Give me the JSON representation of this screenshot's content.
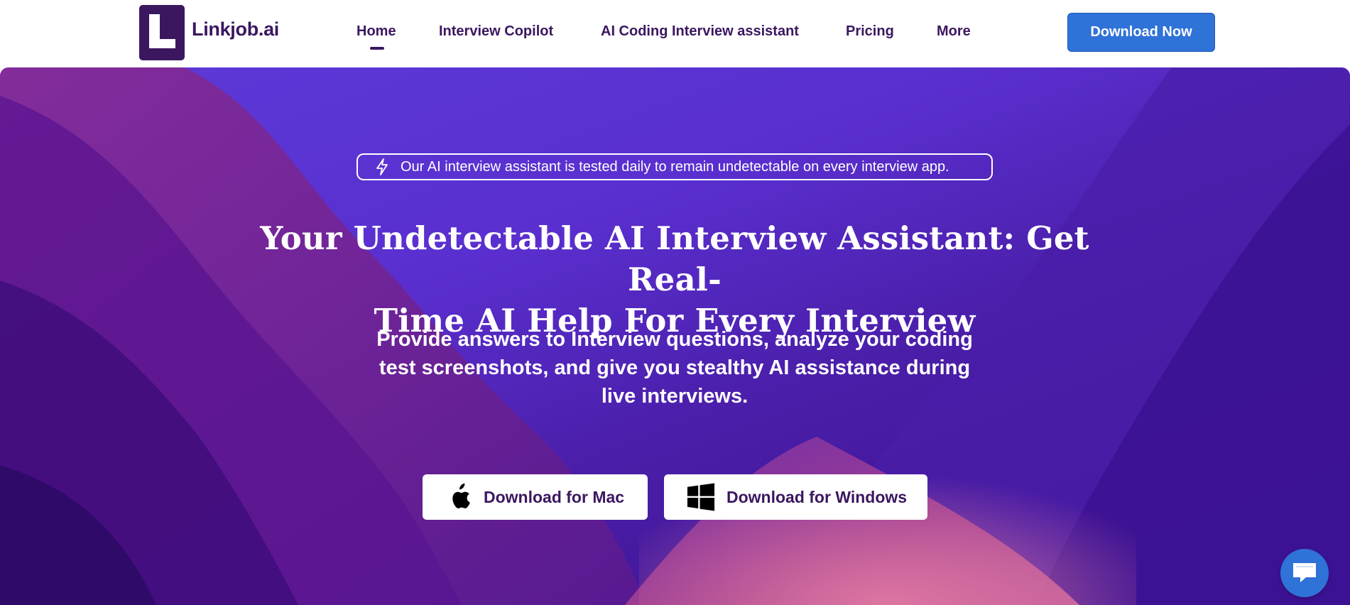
{
  "header": {
    "logo_text": "Linkjob.ai",
    "nav": [
      {
        "label": "Home",
        "active": true
      },
      {
        "label": "Interview Copilot"
      },
      {
        "label": "AI Coding Interview assistant"
      },
      {
        "label": "Pricing"
      },
      {
        "label": "More"
      }
    ],
    "cta_label": "Download Now"
  },
  "hero": {
    "badge_icon": "lightning-icon",
    "badge_text": "Our AI interview assistant is tested daily to remain undetectable on every interview app.",
    "headline_line1": "Your Undetectable AI Interview Assistant: Get Real-",
    "headline_line2": "Time AI Help For Every Interview",
    "subhead_line1": "Provide answers to Interview questions, analyze your coding",
    "subhead_line2": "test screenshots, and give you stealthy AI assistance during",
    "subhead_line3": "live interviews.",
    "buttons": [
      {
        "label": "Download for Mac",
        "icon": "apple-icon"
      },
      {
        "label": "Download for Windows",
        "icon": "windows-icon"
      }
    ]
  },
  "chat_widget": {
    "icon": "chat-bubble-icon"
  },
  "colors": {
    "brand": "#3b1760",
    "accent": "#2f72d8",
    "hero_gradient_start": "#5c3ad9",
    "hero_gradient_end": "#3a0f86"
  }
}
